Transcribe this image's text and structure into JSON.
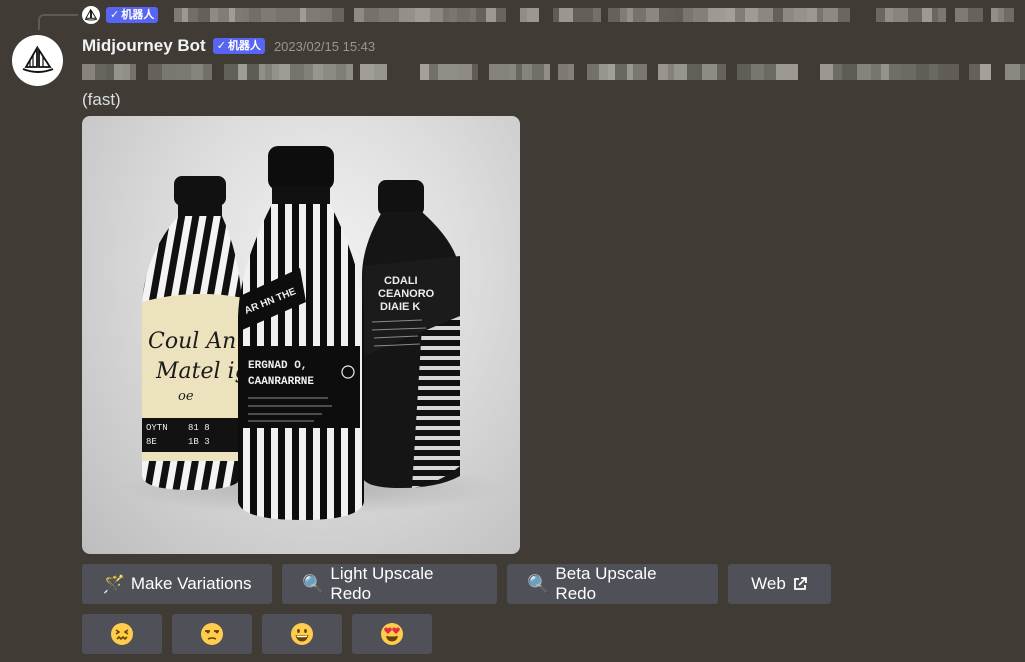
{
  "message": {
    "author": "Midjourney Bot",
    "bot_badge": "机器人",
    "reply_badge": "机器人",
    "timestamp": "2023/02/15 15:43",
    "mode_text": "(fast)"
  },
  "image": {
    "bottles": [
      {
        "label_text": "Coul Anu Matel ig"
      },
      {
        "label_text": "ERGNAD O, CAANRARRNE"
      },
      {
        "label_text": "CDALI CEANORO DIAIE K"
      }
    ]
  },
  "buttons": [
    {
      "label": "Make Variations",
      "icon": "magic-wand-icon",
      "glyph": "🪄"
    },
    {
      "label": "Light Upscale Redo",
      "icon": "magnifier-icon",
      "glyph": "🔍"
    },
    {
      "label": "Beta Upscale Redo",
      "icon": "magnifier-icon",
      "glyph": "🔍"
    },
    {
      "label": "Web",
      "icon": "external-link-icon",
      "glyph": "↗"
    }
  ],
  "reactions": [
    {
      "icon": "confounded-face-icon",
      "glyph": "😖"
    },
    {
      "icon": "unamused-face-icon",
      "glyph": "😒"
    },
    {
      "icon": "grinning-face-icon",
      "glyph": "😀"
    },
    {
      "icon": "heart-eyes-face-icon",
      "glyph": "😍"
    }
  ],
  "colors": {
    "background": "#403b35",
    "badge": "#5865f2",
    "button": "#4f5058"
  }
}
